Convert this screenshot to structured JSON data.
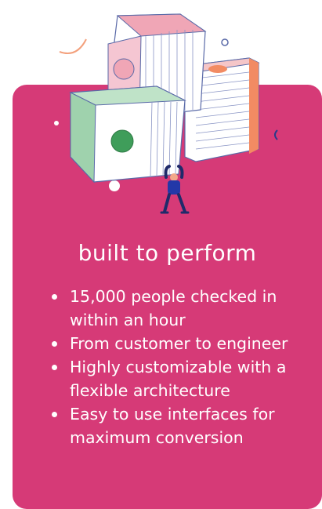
{
  "card": {
    "color": "#d63a77"
  },
  "heading": "built to perform",
  "features": [
    "15,000 people checked in within an hour",
    "From customer to engineer",
    "Highly customizable with a flexible architecture",
    "Easy to use interfaces for maximum conversion"
  ],
  "illustration": {
    "icon": "person-lifting-stack-of-servers-illustration"
  }
}
